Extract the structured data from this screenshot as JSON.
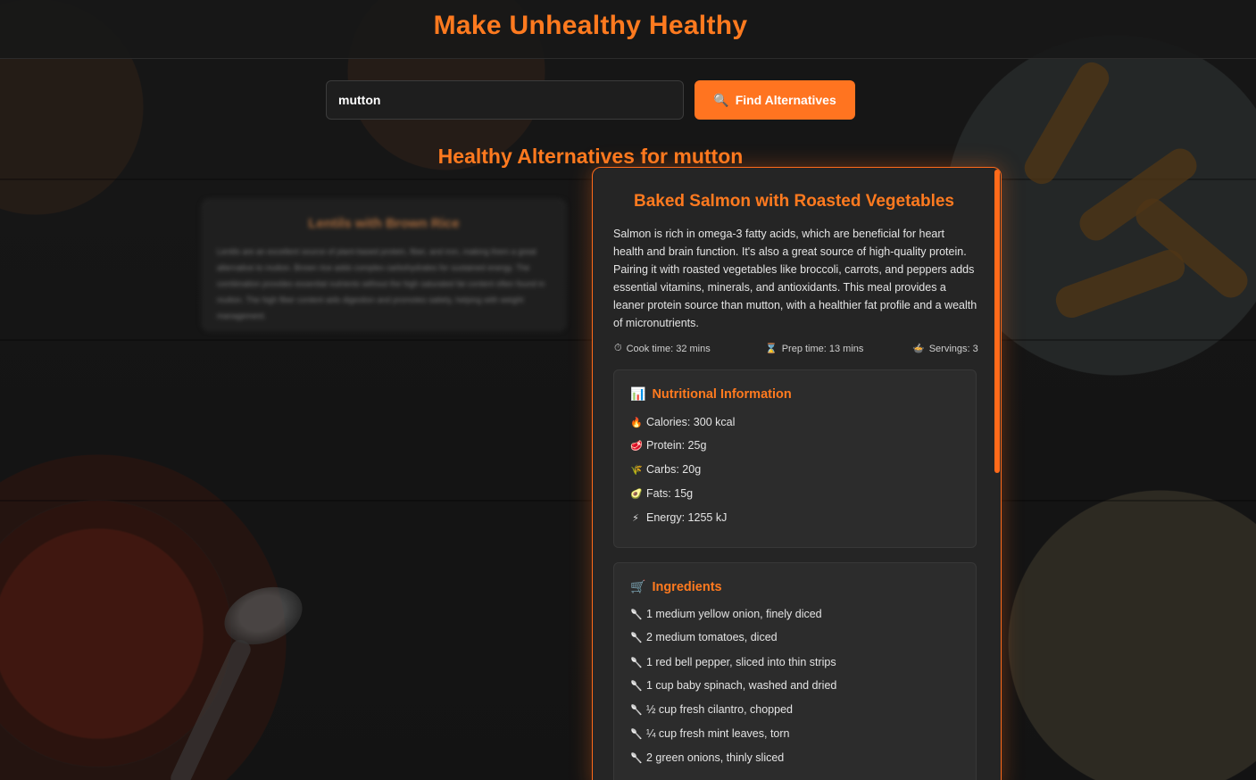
{
  "header": {
    "title": "Make Unhealthy Healthy"
  },
  "search": {
    "value": "mutton",
    "button_label": "Find Alternatives",
    "button_icon": "magnifier-icon"
  },
  "results": {
    "heading": "Healthy Alternatives for mutton",
    "background_card": {
      "title": "Lentils with Brown Rice",
      "description": "Lentils are an excellent source of plant-based protein, fiber, and iron, making them a great alternative to mutton. Brown rice adds complex carbohydrates for sustained energy. The combination provides essential nutrients without the high saturated fat content often found in mutton. The high fiber content aids digestion and promotes satiety, helping with weight management."
    },
    "card": {
      "title": "Baked Salmon with Roasted Vegetables",
      "description": "Salmon is rich in omega-3 fatty acids, which are beneficial for heart health and brain function. It's also a great source of high-quality protein. Pairing it with roasted vegetables like broccoli, carrots, and peppers adds essential vitamins, minerals, and antioxidants. This meal provides a leaner protein source than mutton, with a healthier fat profile and a wealth of micronutrients.",
      "meta": {
        "cook_time": "Cook time: 32 mins",
        "prep_time": "Prep time: 13 mins",
        "servings": "Servings: 3"
      },
      "nutrition": {
        "title": "Nutritional Information",
        "items": [
          {
            "icon": "fire-icon",
            "label": "Calories: 300 kcal"
          },
          {
            "icon": "meat-icon",
            "label": "Protein: 25g"
          },
          {
            "icon": "grain-icon",
            "label": "Carbs: 20g"
          },
          {
            "icon": "avocado-icon",
            "label": "Fats: 15g"
          },
          {
            "icon": "lightning-icon",
            "label": "Energy: 1255 kJ"
          }
        ]
      },
      "ingredients": {
        "title": "Ingredients",
        "items": [
          "1 medium yellow onion, finely diced",
          "2 medium tomatoes, diced",
          "1 red bell pepper, sliced into thin strips",
          "1 cup baby spinach, washed and dried",
          "½ cup fresh cilantro, chopped",
          "¼ cup fresh mint leaves, torn",
          "2 green onions, thinly sliced"
        ]
      }
    }
  },
  "colors": {
    "accent": "#ff7420",
    "card_bg": "#252525",
    "panel_bg": "#2c2c2c"
  }
}
